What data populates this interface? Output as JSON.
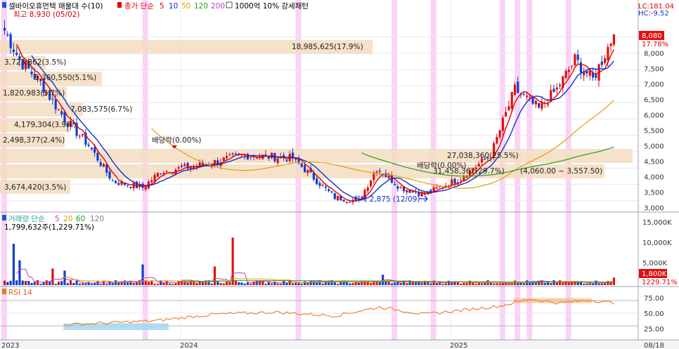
{
  "header": {
    "stock_name": "셀바이오휴먼텍 매물대 수(10)",
    "ma_label": "종가 단순",
    "ma_periods": [
      "5",
      "10",
      "50",
      "120",
      "200"
    ],
    "ma_colors": [
      "#e00000",
      "#1030d0",
      "#e0a000",
      "#20a020",
      "#c040c0"
    ],
    "indicator_label": "1000억 10% 강세패턴",
    "high_label": "최고 8,930 (05/02)",
    "lc_label": "LC:181.04",
    "hc_label": "HC:-9.52"
  },
  "right_axis": {
    "price_ticks": [
      "8,000",
      "7,500",
      "7,000",
      "6,500",
      "6,000",
      "5,500",
      "5,000",
      "4,500",
      "4,000",
      "3,500",
      "3,000"
    ],
    "current_price": "8,080",
    "current_change": "17.78%",
    "volume_ticks": [
      "15,000K",
      "10,000K",
      "5,000K"
    ],
    "current_volume": "1,800K",
    "current_volume_ratio": "1229.71%",
    "rsi_ticks": [
      "75.00",
      "50.00",
      "25.00"
    ]
  },
  "annotations": {
    "low_label": "최저 2,875 (12/09)",
    "dividend_1": "배당락(0.00%)",
    "dividend_2": "배당락(0.00%)",
    "range_label": "(4,060.00 ~ 3,557.50)"
  },
  "volume_profile": [
    {
      "label": "18,985,625(17.9%)"
    },
    {
      "label": "3,723,862(3.5%)"
    },
    {
      "label": "5,360,550(5.1%)"
    },
    {
      "label": "1,820,983(1.7%)"
    },
    {
      "label": "7,083,575(6.7%)"
    },
    {
      "label": "4,179,304(3.9%)"
    },
    {
      "label": "2,498,377(2.4%)"
    },
    {
      "label": "27,038,360(25.5%)"
    },
    {
      "label": "31,458,362(29.7%)"
    },
    {
      "label": "3,674,420(3.5%)"
    }
  ],
  "volume_panel": {
    "title": "거래량 단순",
    "ma_periods": [
      "5",
      "20",
      "60",
      "120"
    ],
    "ma_colors": [
      "#c040c0",
      "#e0a000",
      "#20a020",
      "#808080"
    ],
    "value_label": "1,799,632주(1,229.71%)"
  },
  "rsi_panel": {
    "title": "RSI 14"
  },
  "x_axis": {
    "labels": [
      "2023",
      "2024",
      "2025",
      "08/18"
    ]
  },
  "chart_data": {
    "type": "candlestick",
    "title": "셀바이오휴먼텍 매물대 수(10)",
    "price_ylim": [
      2700,
      8700
    ],
    "price_axis_ticks": [
      3000,
      3500,
      4000,
      4500,
      5000,
      5500,
      6000,
      6500,
      7000,
      7500,
      8000
    ],
    "period_high": 8930,
    "period_low": 2875,
    "last_close": 8080,
    "last_change_pct": 17.78,
    "last_volume": 1799632,
    "volume_ratio_pct": 1229.71,
    "price_control_points": [
      {
        "i": 0,
        "p": 8200
      },
      {
        "i": 5,
        "p": 7300
      },
      {
        "i": 12,
        "p": 6600
      },
      {
        "i": 20,
        "p": 5500
      },
      {
        "i": 28,
        "p": 4700
      },
      {
        "i": 36,
        "p": 3600
      },
      {
        "i": 46,
        "p": 3400
      },
      {
        "i": 52,
        "p": 3900
      },
      {
        "i": 66,
        "p": 4100
      },
      {
        "i": 80,
        "p": 4400
      },
      {
        "i": 96,
        "p": 4300
      },
      {
        "i": 110,
        "p": 3100
      },
      {
        "i": 118,
        "p": 3000
      },
      {
        "i": 124,
        "p": 4000
      },
      {
        "i": 132,
        "p": 3400
      },
      {
        "i": 140,
        "p": 3200
      },
      {
        "i": 152,
        "p": 3700
      },
      {
        "i": 162,
        "p": 4400
      },
      {
        "i": 170,
        "p": 6400
      },
      {
        "i": 178,
        "p": 5800
      },
      {
        "i": 184,
        "p": 6400
      },
      {
        "i": 190,
        "p": 7300
      },
      {
        "i": 196,
        "p": 6700
      },
      {
        "i": 203,
        "p": 8080
      }
    ],
    "volume_spikes": [
      {
        "i": 3,
        "v": 10000
      },
      {
        "i": 5,
        "v": 6000
      },
      {
        "i": 16,
        "v": 4000
      },
      {
        "i": 20,
        "v": 3500
      },
      {
        "i": 46,
        "v": 5000
      },
      {
        "i": 70,
        "v": 4500
      },
      {
        "i": 76,
        "v": 11500
      },
      {
        "i": 126,
        "v": 2500
      },
      {
        "i": 203,
        "v": 1800
      }
    ],
    "volume_ylim": [
      0,
      17000
    ],
    "volume_axis_ticks": [
      5000,
      10000,
      15000
    ],
    "volume_unit": "K",
    "rsi_control_points": [
      {
        "i": 0,
        "r": 30
      },
      {
        "i": 20,
        "r": 27
      },
      {
        "i": 50,
        "r": 35
      },
      {
        "i": 70,
        "r": 48
      },
      {
        "i": 90,
        "r": 52
      },
      {
        "i": 110,
        "r": 45
      },
      {
        "i": 125,
        "r": 62
      },
      {
        "i": 140,
        "r": 48
      },
      {
        "i": 165,
        "r": 64
      },
      {
        "i": 175,
        "r": 78
      },
      {
        "i": 185,
        "r": 70
      },
      {
        "i": 195,
        "r": 76
      },
      {
        "i": 203,
        "r": 70
      }
    ],
    "rsi_ylim": [
      0,
      100
    ],
    "rsi_axis_ticks": [
      25,
      50,
      75
    ]
  }
}
